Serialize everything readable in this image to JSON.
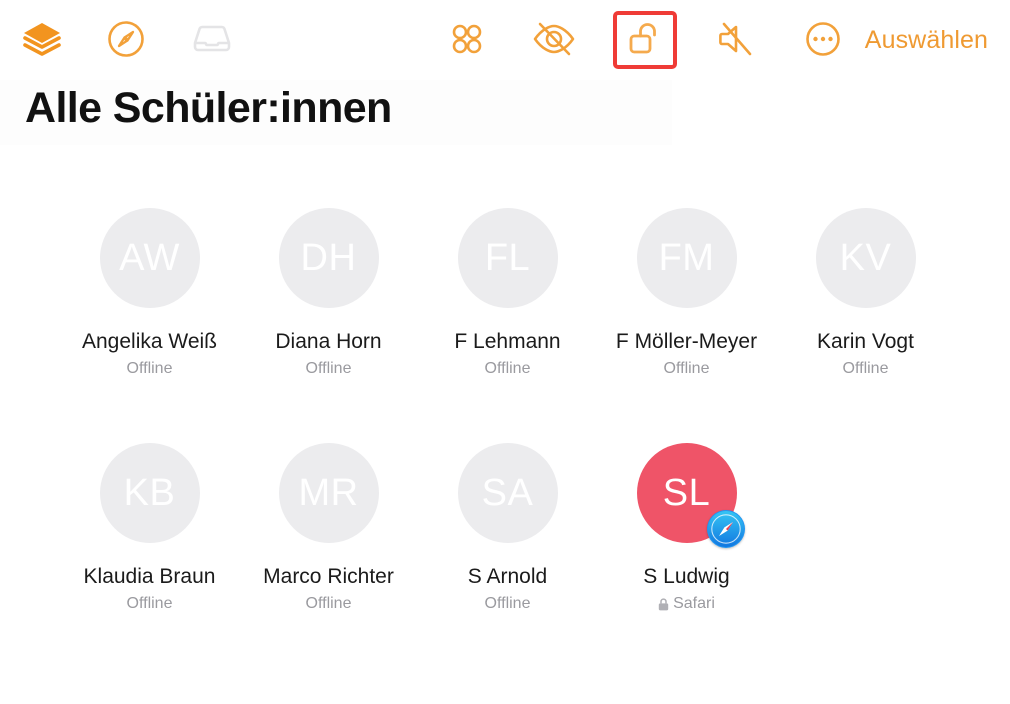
{
  "toolbar": {
    "left_items": [
      {
        "name": "layers-icon",
        "icon": "layers-icon",
        "state": "active"
      },
      {
        "name": "compass-icon",
        "icon": "compass-icon",
        "state": "active"
      },
      {
        "name": "inbox-icon",
        "icon": "inbox-icon",
        "state": "disabled"
      }
    ],
    "right_items": [
      {
        "name": "grid-apps-icon",
        "icon": "grid-apps-icon",
        "state": "active",
        "highlighted": false
      },
      {
        "name": "eye-slash-icon",
        "icon": "eye-slash-icon",
        "state": "active",
        "highlighted": false
      },
      {
        "name": "unlock-icon",
        "icon": "unlock-icon",
        "state": "active",
        "highlighted": true
      },
      {
        "name": "speaker-mute-icon",
        "icon": "speaker-mute-icon",
        "state": "active",
        "highlighted": false
      },
      {
        "name": "more-circle-icon",
        "icon": "more-circle-icon",
        "state": "active",
        "highlighted": false
      }
    ],
    "select_label": "Auswählen",
    "accent_color": "#ef9a32",
    "disabled_color": "#e3e3e5",
    "highlight_color": "#ef3b36"
  },
  "page": {
    "title": "Alle Schüler:innen"
  },
  "students": [
    {
      "initials": "AW",
      "name": "Angelika Weiß",
      "status": "Offline",
      "locked": false,
      "active": false,
      "badge": ""
    },
    {
      "initials": "DH",
      "name": "Diana Horn",
      "status": "Offline",
      "locked": false,
      "active": false,
      "badge": ""
    },
    {
      "initials": "FL",
      "name": "F Lehmann",
      "status": "Offline",
      "locked": false,
      "active": false,
      "badge": ""
    },
    {
      "initials": "FM",
      "name": "F Möller-Meyer",
      "status": "Offline",
      "locked": false,
      "active": false,
      "badge": ""
    },
    {
      "initials": "KV",
      "name": "Karin Vogt",
      "status": "Offline",
      "locked": false,
      "active": false,
      "badge": ""
    },
    {
      "initials": "KB",
      "name": "Klaudia Braun",
      "status": "Offline",
      "locked": false,
      "active": false,
      "badge": ""
    },
    {
      "initials": "MR",
      "name": "Marco Richter",
      "status": "Offline",
      "locked": false,
      "active": false,
      "badge": ""
    },
    {
      "initials": "SA",
      "name": "S Arnold",
      "status": "Offline",
      "locked": false,
      "active": false,
      "badge": ""
    },
    {
      "initials": "SL",
      "name": "S Ludwig",
      "status": "Safari",
      "locked": true,
      "active": true,
      "badge": "safari-badge-icon"
    }
  ],
  "colors": {
    "avatar_default": "#ececee",
    "avatar_active": "#ef5468",
    "name_text": "#1b1b1b",
    "status_text": "#9a9a9f",
    "title_text": "#111111"
  }
}
